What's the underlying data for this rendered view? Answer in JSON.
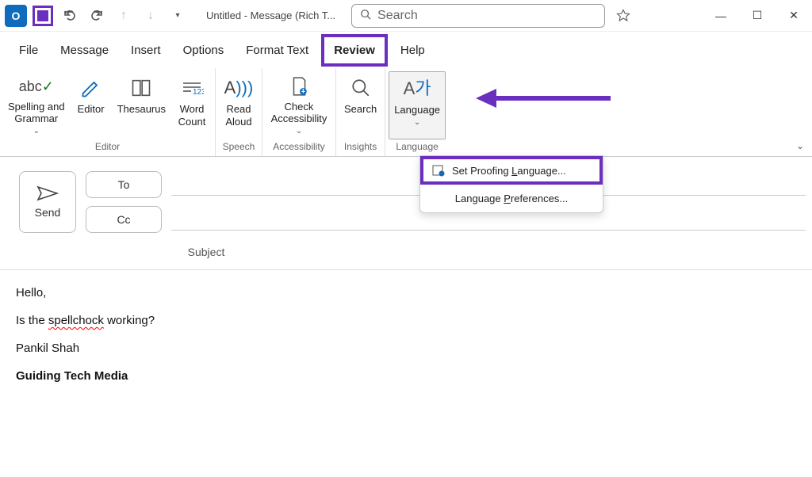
{
  "titlebar": {
    "window_title": "Untitled  -  Message (Rich T...",
    "search_placeholder": "Search"
  },
  "tabs": {
    "file": "File",
    "message": "Message",
    "insert": "Insert",
    "options": "Options",
    "format_text": "Format Text",
    "review": "Review",
    "help": "Help"
  },
  "ribbon": {
    "spelling_grammar": "Spelling and\nGrammar",
    "editor": "Editor",
    "thesaurus": "Thesaurus",
    "word_count": "Word\nCount",
    "read_aloud": "Read\nAloud",
    "check_accessibility": "Check\nAccessibility",
    "search": "Search",
    "language": "Language",
    "groups": {
      "editor": "Editor",
      "speech": "Speech",
      "accessibility": "Accessibility",
      "insights": "Insights",
      "language": "Language"
    }
  },
  "dropdown": {
    "set_proofing_prefix": "Set Proofing ",
    "set_proofing_u": "L",
    "set_proofing_suffix": "anguage...",
    "lang_prefs_prefix": "Language ",
    "lang_prefs_u": "P",
    "lang_prefs_suffix": "references..."
  },
  "compose": {
    "send": "Send",
    "to": "To",
    "cc": "Cc",
    "subject_label": "Subject"
  },
  "body": {
    "greeting": "Hello,",
    "line_prefix": "Is the ",
    "misspelled": "spellchock",
    "line_suffix": " working?",
    "sig_name": "Pankil Shah",
    "sig_company": "Guiding Tech Media"
  },
  "colors": {
    "highlight": "#6b2fbf"
  }
}
